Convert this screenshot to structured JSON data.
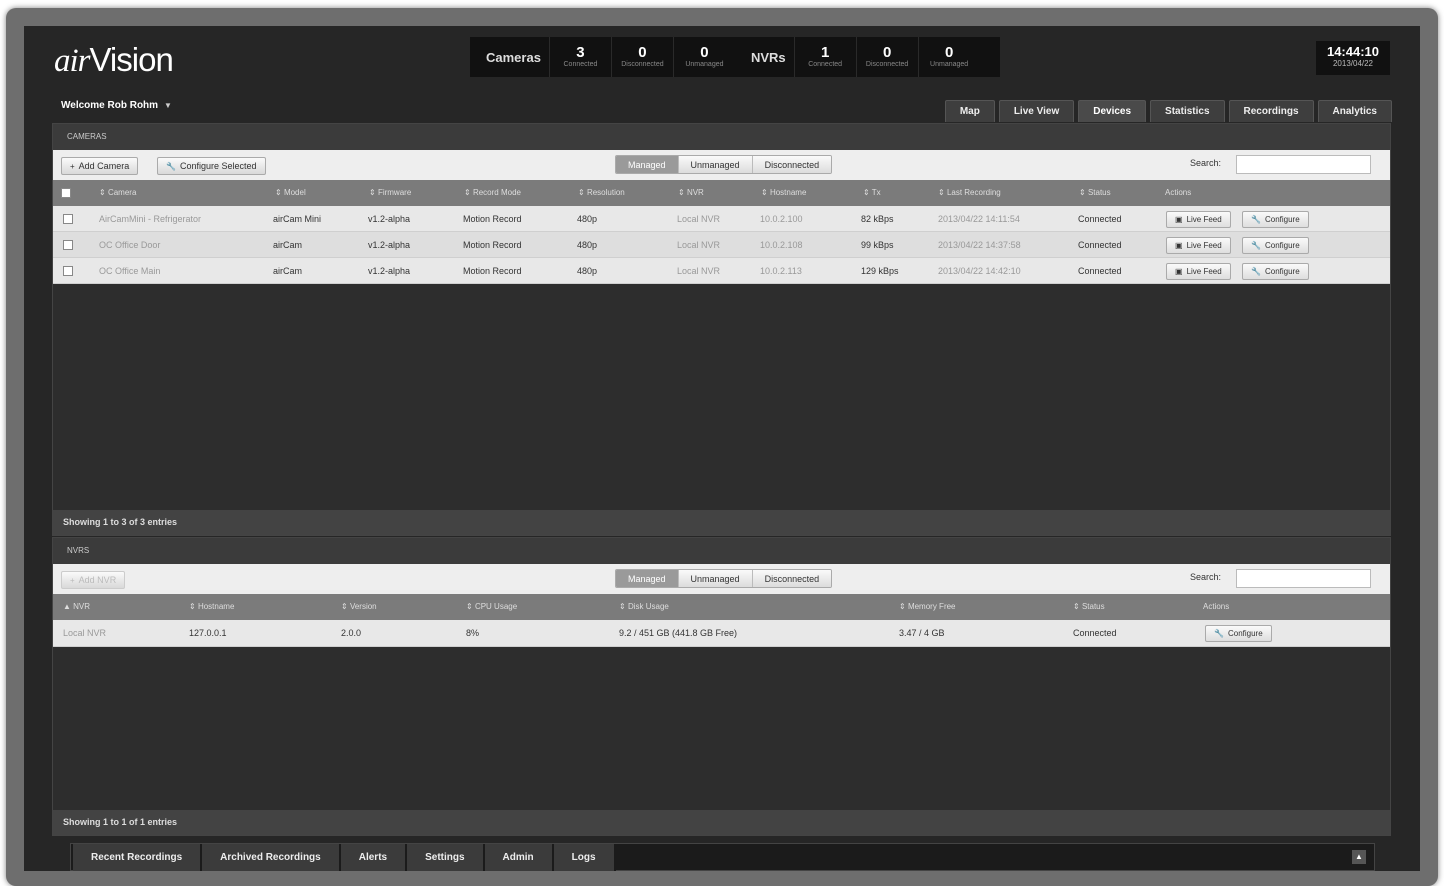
{
  "app": {
    "logo_script": "air",
    "logo_main": "Vision"
  },
  "stats": {
    "cameras_label": "Cameras",
    "cameras": [
      {
        "value": "3",
        "label": "Connected"
      },
      {
        "value": "0",
        "label": "Disconnected"
      },
      {
        "value": "0",
        "label": "Unmanaged"
      }
    ],
    "nvrs_label": "NVRs",
    "nvrs": [
      {
        "value": "1",
        "label": "Connected"
      },
      {
        "value": "0",
        "label": "Disconnected"
      },
      {
        "value": "0",
        "label": "Unmanaged"
      }
    ]
  },
  "clock": {
    "time": "14:44:10",
    "date": "2013/04/22"
  },
  "user": {
    "welcome": "Welcome Rob Rohm"
  },
  "nav": {
    "tabs": [
      "Map",
      "Live View",
      "Devices",
      "Statistics",
      "Recordings",
      "Analytics"
    ],
    "active": "Devices"
  },
  "cameras": {
    "header": "CAMERAS",
    "add_button": "Add Camera",
    "configure_selected": "Configure Selected",
    "filters": [
      "Managed",
      "Unmanaged",
      "Disconnected"
    ],
    "active_filter": "Managed",
    "search_label": "Search:",
    "columns": [
      "Camera",
      "Model",
      "Firmware",
      "Record Mode",
      "Resolution",
      "NVR",
      "Hostname",
      "Tx",
      "Last Recording",
      "Status",
      "Actions"
    ],
    "rows": [
      {
        "camera": "AirCamMini - Refrigerator",
        "model": "airCam Mini",
        "firmware": "v1.2-alpha",
        "record_mode": "Motion Record",
        "resolution": "480p",
        "nvr": "Local NVR",
        "hostname": "10.0.2.100",
        "tx": "82 kBps",
        "last_recording": "2013/04/22 14:11:54",
        "status": "Connected"
      },
      {
        "camera": "OC Office Door",
        "model": "airCam",
        "firmware": "v1.2-alpha",
        "record_mode": "Motion Record",
        "resolution": "480p",
        "nvr": "Local NVR",
        "hostname": "10.0.2.108",
        "tx": "99 kBps",
        "last_recording": "2013/04/22 14:37:58",
        "status": "Connected"
      },
      {
        "camera": "OC Office Main",
        "model": "airCam",
        "firmware": "v1.2-alpha",
        "record_mode": "Motion Record",
        "resolution": "480p",
        "nvr": "Local NVR",
        "hostname": "10.0.2.113",
        "tx": "129 kBps",
        "last_recording": "2013/04/22 14:42:10",
        "status": "Connected"
      }
    ],
    "live_feed_label": "Live Feed",
    "configure_label": "Configure",
    "footer": "Showing 1 to 3 of 3 entries"
  },
  "nvrs": {
    "header": "NVRS",
    "add_button": "Add NVR",
    "filters": [
      "Managed",
      "Unmanaged",
      "Disconnected"
    ],
    "active_filter": "Managed",
    "search_label": "Search:",
    "columns": [
      "NVR",
      "Hostname",
      "Version",
      "CPU Usage",
      "Disk Usage",
      "Memory Free",
      "Status",
      "Actions"
    ],
    "rows": [
      {
        "nvr": "Local NVR",
        "hostname": "127.0.0.1",
        "version": "2.0.0",
        "cpu": "8%",
        "disk": "9.2 / 451 GB (441.8 GB Free)",
        "memory": "3.47 / 4 GB",
        "status": "Connected"
      }
    ],
    "configure_label": "Configure",
    "footer": "Showing 1 to 1 of 1 entries"
  },
  "bottom_tabs": [
    "Recent Recordings",
    "Archived Recordings",
    "Alerts",
    "Settings",
    "Admin",
    "Logs"
  ]
}
